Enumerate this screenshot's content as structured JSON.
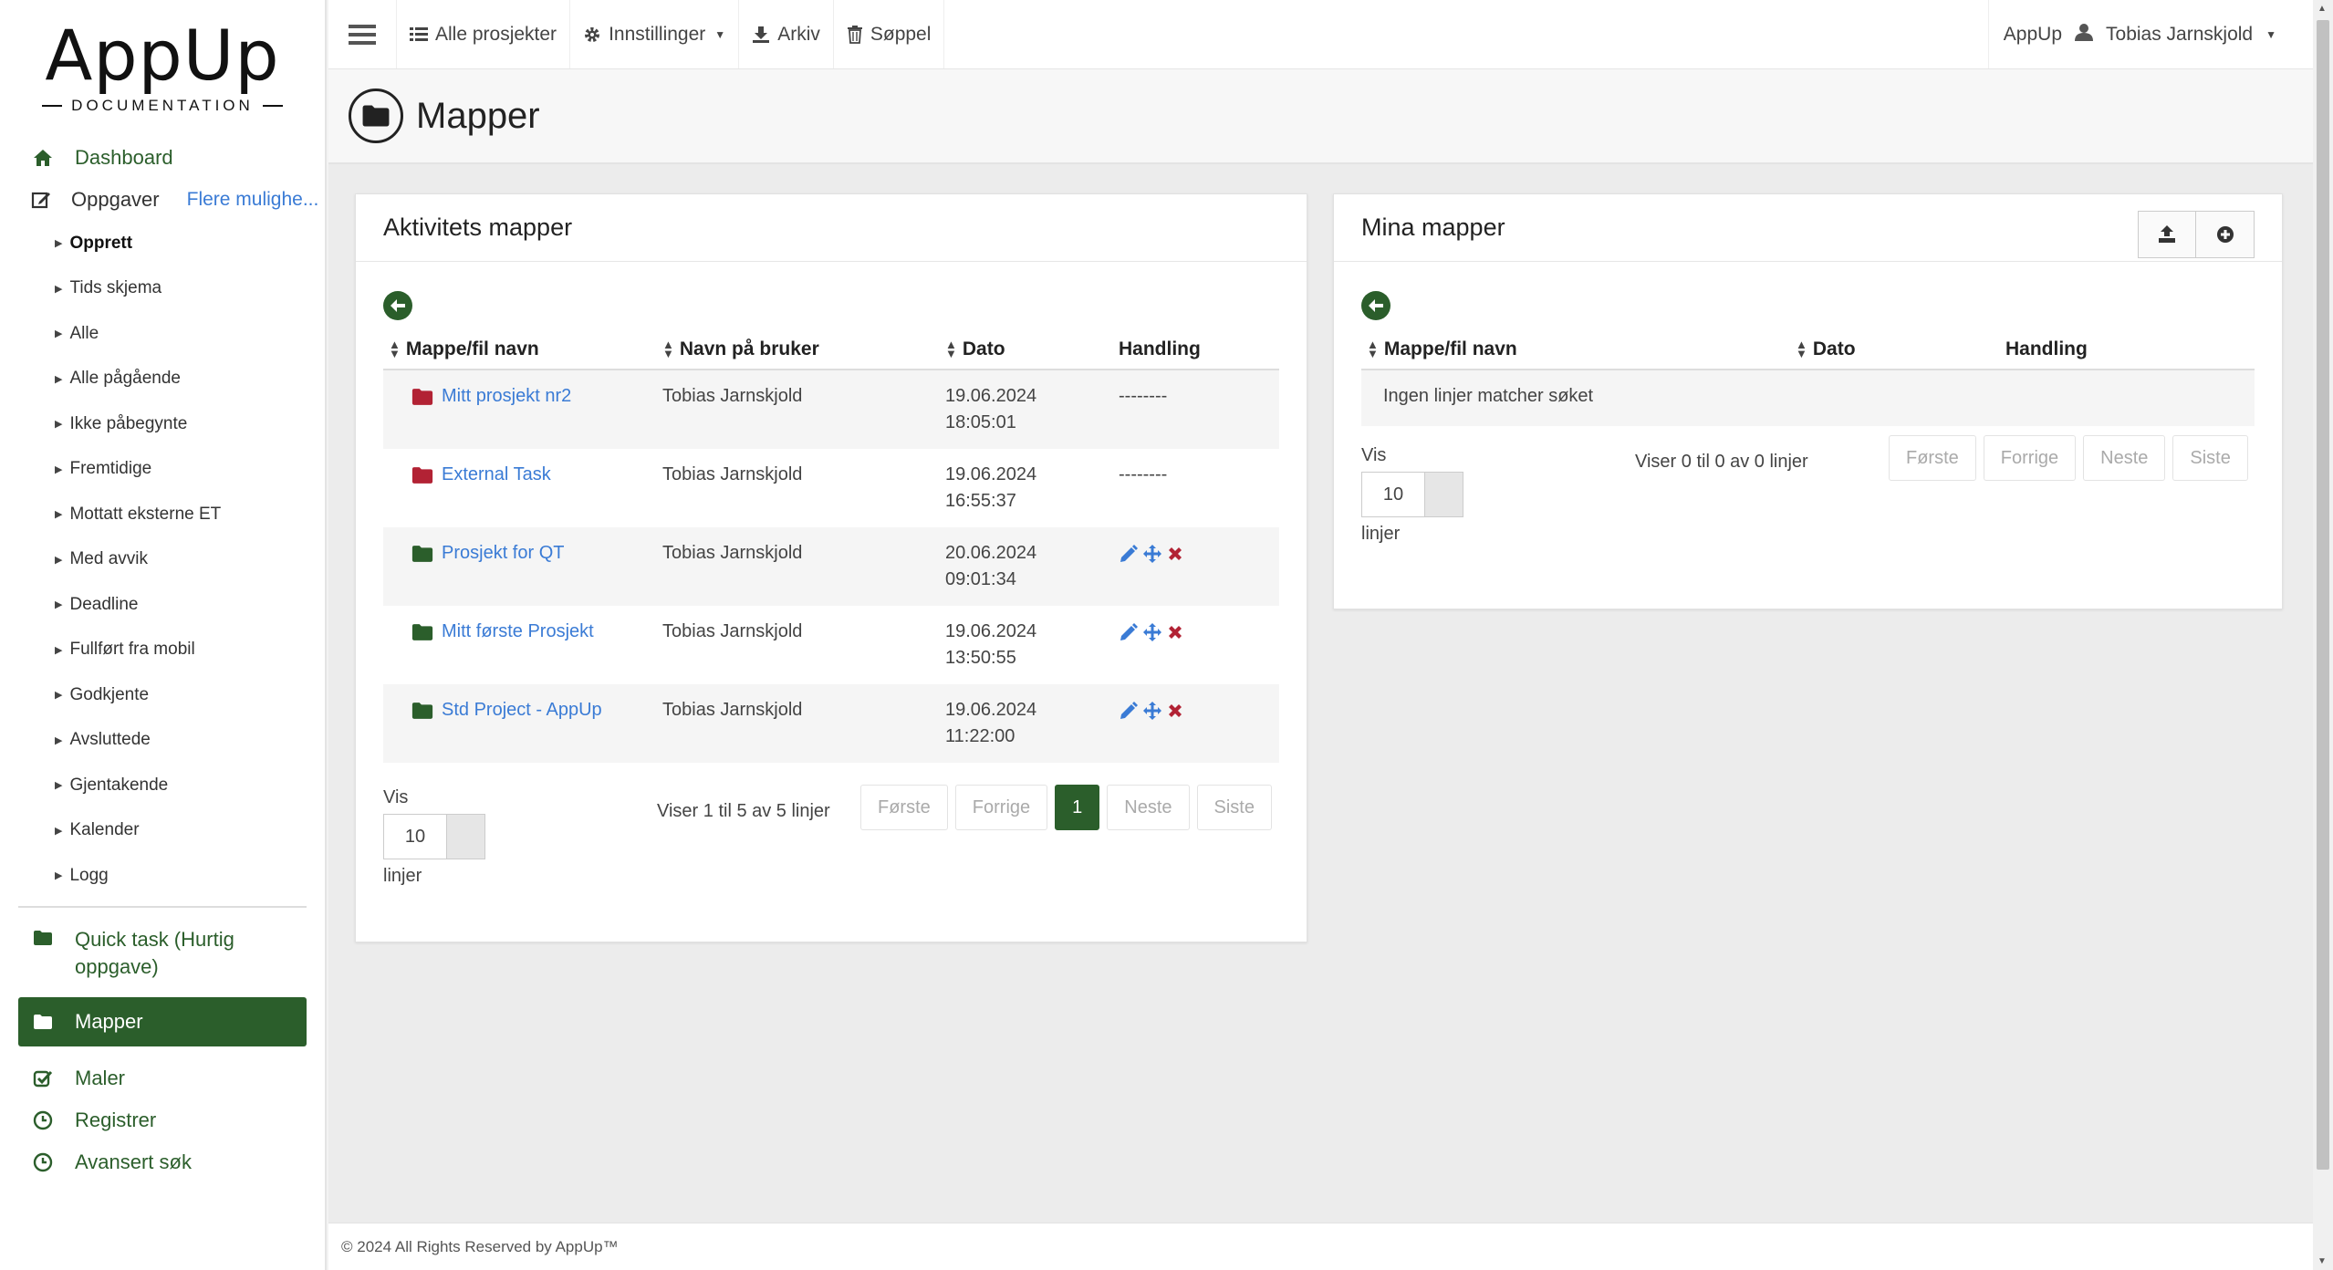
{
  "logo": {
    "title": "AppUp",
    "subtitle": "DOCUMENTATION"
  },
  "sidebar": {
    "dashboard": "Dashboard",
    "tasks": "Oppgaver",
    "more_options": "Flere mulighe...",
    "sub_items": [
      "Opprett",
      "Tids skjema",
      "Alle",
      "Alle pågående",
      "Ikke påbegynte",
      "Fremtidige",
      "Mottatt eksterne ET",
      "Med avvik",
      "Deadline",
      "Fullført fra mobil",
      "Godkjente",
      "Avsluttede",
      "Gjentakende",
      "Kalender",
      "Logg"
    ],
    "quick_task": "Quick task (Hurtig oppgave)",
    "folders": "Mapper",
    "templates": "Maler",
    "register": "Registrer",
    "advanced_search": "Avansert søk"
  },
  "topbar": {
    "all_projects": "Alle prosjekter",
    "settings": "Innstillinger",
    "archive": "Arkiv",
    "trash": "Søppel",
    "app_name": "AppUp",
    "user": "Tobias Jarnskjold"
  },
  "page": {
    "title": "Mapper"
  },
  "activity_panel": {
    "title": "Aktivitets mapper",
    "columns": [
      "Mappe/fil navn",
      "Navn på bruker",
      "Dato",
      "Handling"
    ],
    "rows": [
      {
        "name": "Mitt prosjekt nr2",
        "user": "Tobias Jarnskjold",
        "date": "19.06.2024",
        "time": "18:05:01",
        "action": "--------",
        "color": "#b22234"
      },
      {
        "name": "External Task",
        "user": "Tobias Jarnskjold",
        "date": "19.06.2024",
        "time": "16:55:37",
        "action": "--------",
        "color": "#b22234"
      },
      {
        "name": "Prosjekt for QT",
        "user": "Tobias Jarnskjold",
        "date": "20.06.2024",
        "time": "09:01:34",
        "action": "",
        "color": "#2b5e2b"
      },
      {
        "name": "Mitt første Prosjekt",
        "user": "Tobias Jarnskjold",
        "date": "19.06.2024",
        "time": "13:50:55",
        "action": "",
        "color": "#2b5e2b"
      },
      {
        "name": "Std Project - AppUp",
        "user": "Tobias Jarnskjold",
        "date": "19.06.2024",
        "time": "11:22:00",
        "action": "",
        "color": "#2b5e2b"
      }
    ],
    "show_label": "Vis",
    "page_size": "10",
    "rows_label": "linjer",
    "info": "Viser 1 til 5 av 5 linjer",
    "pager": {
      "first": "Første",
      "prev": "Forrige",
      "current": "1",
      "next": "Neste",
      "last": "Siste"
    }
  },
  "my_panel": {
    "title": "Mina mapper",
    "columns": [
      "Mappe/fil navn",
      "Dato",
      "Handling"
    ],
    "empty": "Ingen linjer matcher søket",
    "show_label": "Vis",
    "page_size": "10",
    "rows_label": "linjer",
    "info": "Viser 0 til 0 av 0 linjer",
    "pager": {
      "first": "Første",
      "prev": "Forrige",
      "next": "Neste",
      "last": "Siste"
    }
  },
  "footer": {
    "copyright": "© 2024 All Rights Reserved by AppUp™"
  },
  "colors": {
    "accent": "#2b5e2b",
    "link": "#3a7bd5",
    "danger": "#b22234"
  }
}
